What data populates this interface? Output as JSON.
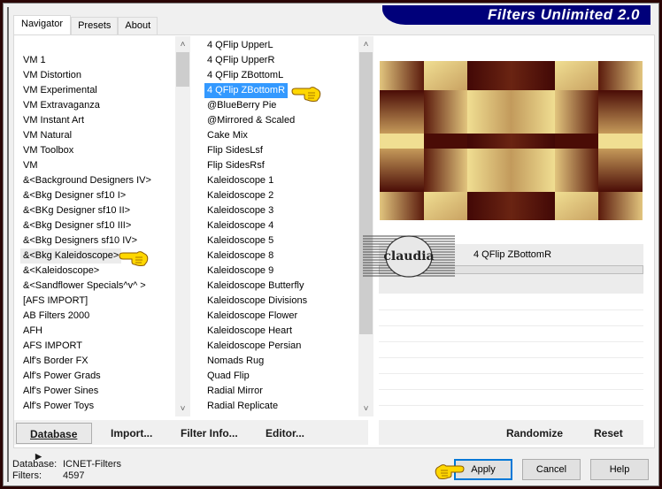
{
  "app": {
    "title": "Filters Unlimited 2.0"
  },
  "tabs": [
    {
      "label": "Navigator",
      "active": true
    },
    {
      "label": "Presets",
      "active": false
    },
    {
      "label": "About",
      "active": false
    }
  ],
  "categories": {
    "items": [
      "VM 1",
      "VM Distortion",
      "VM Experimental",
      "VM Extravaganza",
      "VM Instant Art",
      "VM Natural",
      "VM Toolbox",
      "VM",
      "&<Background Designers IV>",
      "&<Bkg Designer sf10 I>",
      "&<BKg Designer sf10 II>",
      "&<Bkg Designer sf10 III>",
      "&<Bkg Designers sf10 IV>",
      "&<Bkg Kaleidoscope>",
      "&<Kaleidoscope>",
      "&<Sandflower Specials^v^ >",
      "[AFS IMPORT]",
      "AB Filters 2000",
      "AFH",
      "AFS IMPORT",
      "Alf's Border FX",
      "Alf's Power Grads",
      "Alf's Power Sines",
      "Alf's Power Toys"
    ],
    "highlighted": "&<Bkg Kaleidoscope>"
  },
  "filters": {
    "items": [
      "4 QFlip UpperL",
      "4 QFlip UpperR",
      "4 QFlip ZBottomL",
      "4 QFlip ZBottomR",
      "@BlueBerry Pie",
      "@Mirrored & Scaled",
      "Cake Mix",
      "Flip SidesLsf",
      "Flip SidesRsf",
      "Kaleidoscope 1",
      "Kaleidoscope 2",
      "Kaleidoscope 3",
      "Kaleidoscope 4",
      "Kaleidoscope 5",
      "Kaleidoscope 8",
      "Kaleidoscope 9",
      "Kaleidoscope Butterfly",
      "Kaleidoscope Divisions",
      "Kaleidoscope Flower",
      "Kaleidoscope Heart",
      "Kaleidoscope Persian",
      "Nomads Rug",
      "Quad Flip",
      "Radial Mirror",
      "Radial Replicate"
    ],
    "selected": "4 QFlip ZBottomR"
  },
  "preview": {
    "filter_name": "4 QFlip ZBottomR",
    "watermark": "claudia",
    "colors": {
      "light": "#f0de92",
      "mid": "#b8884e",
      "dark": "#4a0c06"
    }
  },
  "commands": {
    "database": "Database",
    "import": "Import...",
    "filter_info": "Filter Info...",
    "editor": "Editor...",
    "randomize": "Randomize",
    "reset": "Reset"
  },
  "status": {
    "database_label": "Database:",
    "database_value": "ICNET-Filters",
    "filters_label": "Filters:",
    "filters_value": "4597"
  },
  "buttons": {
    "apply": "Apply",
    "cancel": "Cancel",
    "help": "Help"
  },
  "colors": {
    "banner": "#00007a",
    "selection": "#3399ff",
    "default_button_border": "#0078d7"
  }
}
